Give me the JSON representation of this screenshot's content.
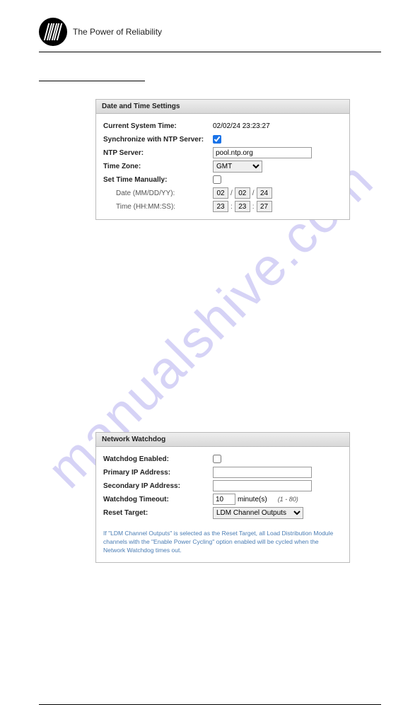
{
  "header": {
    "tagline": "The Power of Reliability"
  },
  "watermark": "manualshive.com",
  "datetime_panel": {
    "title": "Date and Time Settings",
    "rows": {
      "current_time_label": "Current System Time:",
      "current_time_value": "02/02/24 23:23:27",
      "sync_label": "Synchronize with NTP Server:",
      "sync_checked": true,
      "ntp_label": "NTP Server:",
      "ntp_value": "pool.ntp.org",
      "tz_label": "Time Zone:",
      "tz_value": "GMT",
      "manual_label": "Set Time Manually:",
      "manual_checked": false,
      "date_label": "Date (MM/DD/YY):",
      "date_mm": "02",
      "date_dd": "02",
      "date_yy": "24",
      "date_sep": "/",
      "time_label": "Time (HH:MM:SS):",
      "time_hh": "23",
      "time_mm": "23",
      "time_ss": "27",
      "time_sep": ":"
    }
  },
  "watchdog_panel": {
    "title": "Network Watchdog",
    "rows": {
      "enabled_label": "Watchdog Enabled:",
      "enabled_checked": false,
      "primary_label": "Primary IP Address:",
      "primary_value": "",
      "secondary_label": "Secondary IP Address:",
      "secondary_value": "",
      "timeout_label": "Watchdog Timeout:",
      "timeout_value": "10",
      "timeout_unit": "minute(s)",
      "timeout_hint": "(1 - 80)",
      "reset_label": "Reset Target:",
      "reset_value": "LDM Channel Outputs"
    },
    "footnote": "If \"LDM Channel Outputs\" is selected as the Reset Target, all Load Distribution Module channels with the \"Enable Power Cycling\" option enabled will be cycled when the Network Watchdog times out."
  }
}
